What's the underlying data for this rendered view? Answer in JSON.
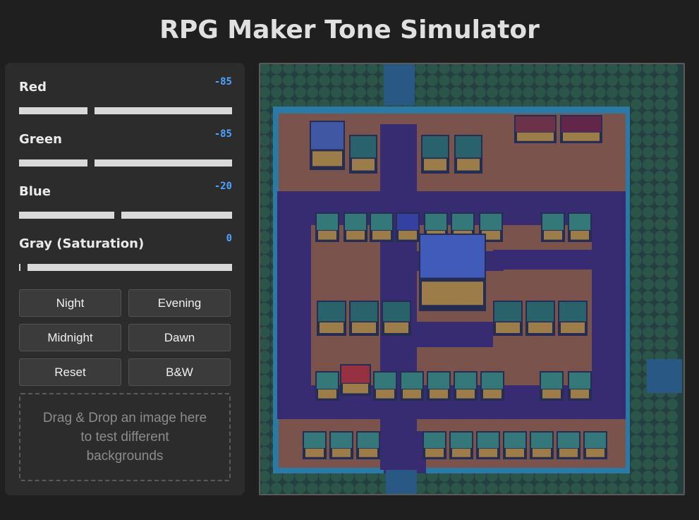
{
  "app": {
    "title": "RPG Maker Tone Simulator"
  },
  "sliders": [
    {
      "label": "Red",
      "value": "-85",
      "level": -85,
      "min": -255,
      "max": 255
    },
    {
      "label": "Green",
      "value": "-85",
      "level": -85,
      "min": -255,
      "max": 255
    },
    {
      "label": "Blue",
      "value": "-20",
      "level": -20,
      "min": -255,
      "max": 255
    },
    {
      "label": "Gray (Saturation)",
      "value": "0",
      "level": 0,
      "min": 0,
      "max": 255
    }
  ],
  "presets": {
    "night": "Night",
    "evening": "Evening",
    "midnight": "Midnight",
    "dawn": "Dawn",
    "reset": "Reset",
    "bw": "B&W"
  },
  "dropzone": {
    "text": "Drag & Drop an image here to test different backgrounds"
  },
  "colors": {
    "accent_value": "#4da3ff",
    "panel_bg": "#2c2c2c",
    "page_bg": "#1f1f1f",
    "road": "#3e3370",
    "ground": "#9a6a3c",
    "tree": "#2f6b3a",
    "water": "#2d9fb8"
  }
}
